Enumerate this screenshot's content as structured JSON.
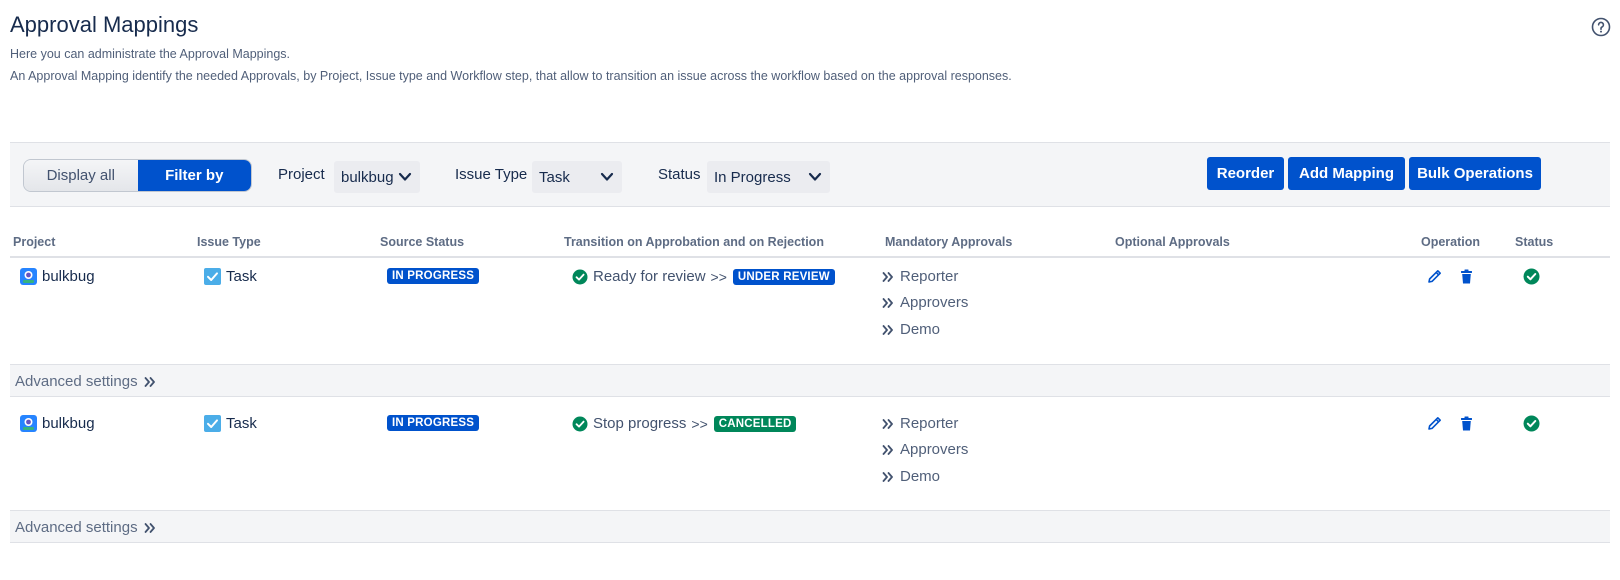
{
  "page": {
    "title": "Approval Mappings",
    "description_1": "Here you can administrate the Approval Mappings.",
    "description_2": "An Approval Mapping identify the needed Approvals, by Project, Issue type and Workflow step, that allow to transition an issue across the workflow based on the approval responses."
  },
  "filter": {
    "display_all": "Display all",
    "filter_by": "Filter by",
    "active_mode": "filter_by",
    "project_label": "Project",
    "project_value": "bulkbug",
    "issue_type_label": "Issue Type",
    "issue_type_value": "Task",
    "status_label": "Status",
    "status_value": "In Progress"
  },
  "actions": {
    "reorder": "Reorder",
    "add_mapping": "Add Mapping",
    "bulk_operations": "Bulk Operations"
  },
  "table": {
    "headers": {
      "project": "Project",
      "issue_type": "Issue Type",
      "source_status": "Source Status",
      "transition": "Transition on Approbation and on Rejection",
      "mandatory": "Mandatory Approvals",
      "optional": "Optional Approvals",
      "operation": "Operation",
      "status": "Status"
    },
    "rows": [
      {
        "project": "bulkbug",
        "issue_type": "Task",
        "source_status": "IN PROGRESS",
        "transition_name": "Ready for review",
        "transition_arrows": ">>",
        "target_status": "UNDER REVIEW",
        "mandatory": [
          "Reporter",
          "Approvers",
          "Demo"
        ],
        "advanced": "Advanced settings"
      },
      {
        "project": "bulkbug",
        "issue_type": "Task",
        "source_status": "IN PROGRESS",
        "transition_name": "Stop progress",
        "transition_arrows": ">>",
        "target_status": "CANCELLED",
        "mandatory": [
          "Reporter",
          "Approvers",
          "Demo"
        ],
        "advanced": "Advanced settings"
      }
    ]
  },
  "colors": {
    "primary": "#0052cc",
    "success": "#00875a",
    "text": "#172b4d",
    "subtle": "#5e6c84",
    "panel": "#f4f5f7"
  },
  "icons": [
    "help-icon",
    "chevron-down-icon",
    "project-avatar-icon",
    "task-checkbox-icon",
    "check-circle-icon",
    "double-chevron-right-icon",
    "edit-pencil-icon",
    "trash-icon"
  ]
}
